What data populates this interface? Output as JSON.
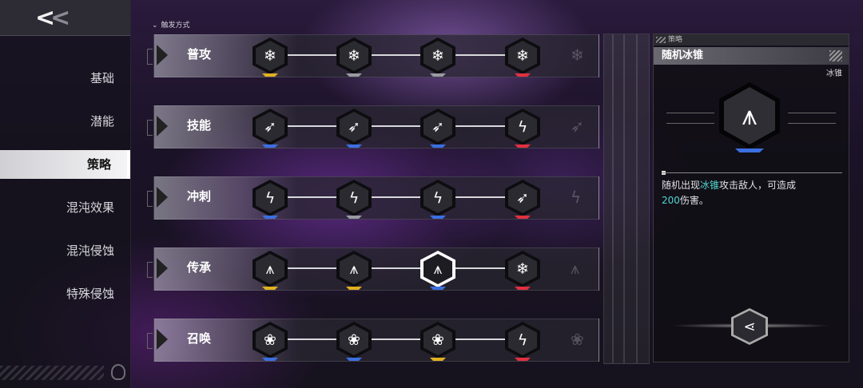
{
  "nav": {
    "back_glyph": "<",
    "back_glyph2": "<",
    "items": [
      {
        "label": "基础",
        "active": false
      },
      {
        "label": "潜能",
        "active": false
      },
      {
        "label": "策略",
        "active": true
      },
      {
        "label": "混沌效果",
        "active": false
      },
      {
        "label": "混沌侵蚀",
        "active": false
      },
      {
        "label": "特殊侵蚀",
        "active": false
      }
    ]
  },
  "section_label": "触发方式",
  "rows": [
    {
      "label": "普攻",
      "icons": [
        "snowflake-icon",
        "snowflake-icon",
        "snowflake-icon",
        "snowflake-icon"
      ],
      "glyphs": [
        "❄",
        "❄",
        "❄",
        "❄"
      ],
      "stripes": [
        "#e0b020",
        "#9a9aa2",
        "#9a9aa2",
        "#e03040"
      ],
      "ghost": "❄"
    },
    {
      "label": "技能",
      "icons": [
        "ice-spear-icon",
        "ice-spear-icon",
        "ice-spear-icon",
        "ice-strike-icon"
      ],
      "glyphs": [
        "➶",
        "➶",
        "➶",
        "ϟ"
      ],
      "stripes": [
        "#3b6fe0",
        "#3b6fe0",
        "#3b6fe0",
        "#e03040"
      ],
      "ghost": "➶"
    },
    {
      "label": "冲刺",
      "icons": [
        "ice-strike-icon",
        "ice-strike-icon",
        "ice-strike-icon",
        "ice-spear-icon"
      ],
      "glyphs": [
        "ϟ",
        "ϟ",
        "ϟ",
        "➶"
      ],
      "stripes": [
        "#3b6fe0",
        "#9a9aa2",
        "#3b6fe0",
        "#e03040"
      ],
      "ghost": "ϟ"
    },
    {
      "label": "传承",
      "icons": [
        "ice-cone-icon",
        "ice-cone-icon",
        "ice-cone-icon",
        "snowflake-icon"
      ],
      "glyphs": [
        "⩚",
        "⩚",
        "⩚",
        "❄"
      ],
      "stripes": [
        "#e0b020",
        "#e0b020",
        "#3b6fe0",
        "#e03040"
      ],
      "ghost": "⩚",
      "selected_index": 2
    },
    {
      "label": "召唤",
      "icons": [
        "flower-icon",
        "flower-icon",
        "flower-icon",
        "ice-strike-icon"
      ],
      "glyphs": [
        "❀",
        "❀",
        "❀",
        "ϟ"
      ],
      "stripes": [
        "#3b6fe0",
        "#3b6fe0",
        "#e0b020",
        "#e03040"
      ],
      "ghost": "❀"
    }
  ],
  "detail": {
    "tag": "策略",
    "title": "随机冰锥",
    "element": "冰锥",
    "icon": "ice-cone-icon",
    "icon_glyph": "⩚",
    "desc_pre": "随机出现",
    "desc_hl": "冰锥",
    "desc_mid": "攻击敌人，可造成",
    "desc_num": "200",
    "desc_post": "伤害。",
    "share_glyph": "⋖"
  }
}
